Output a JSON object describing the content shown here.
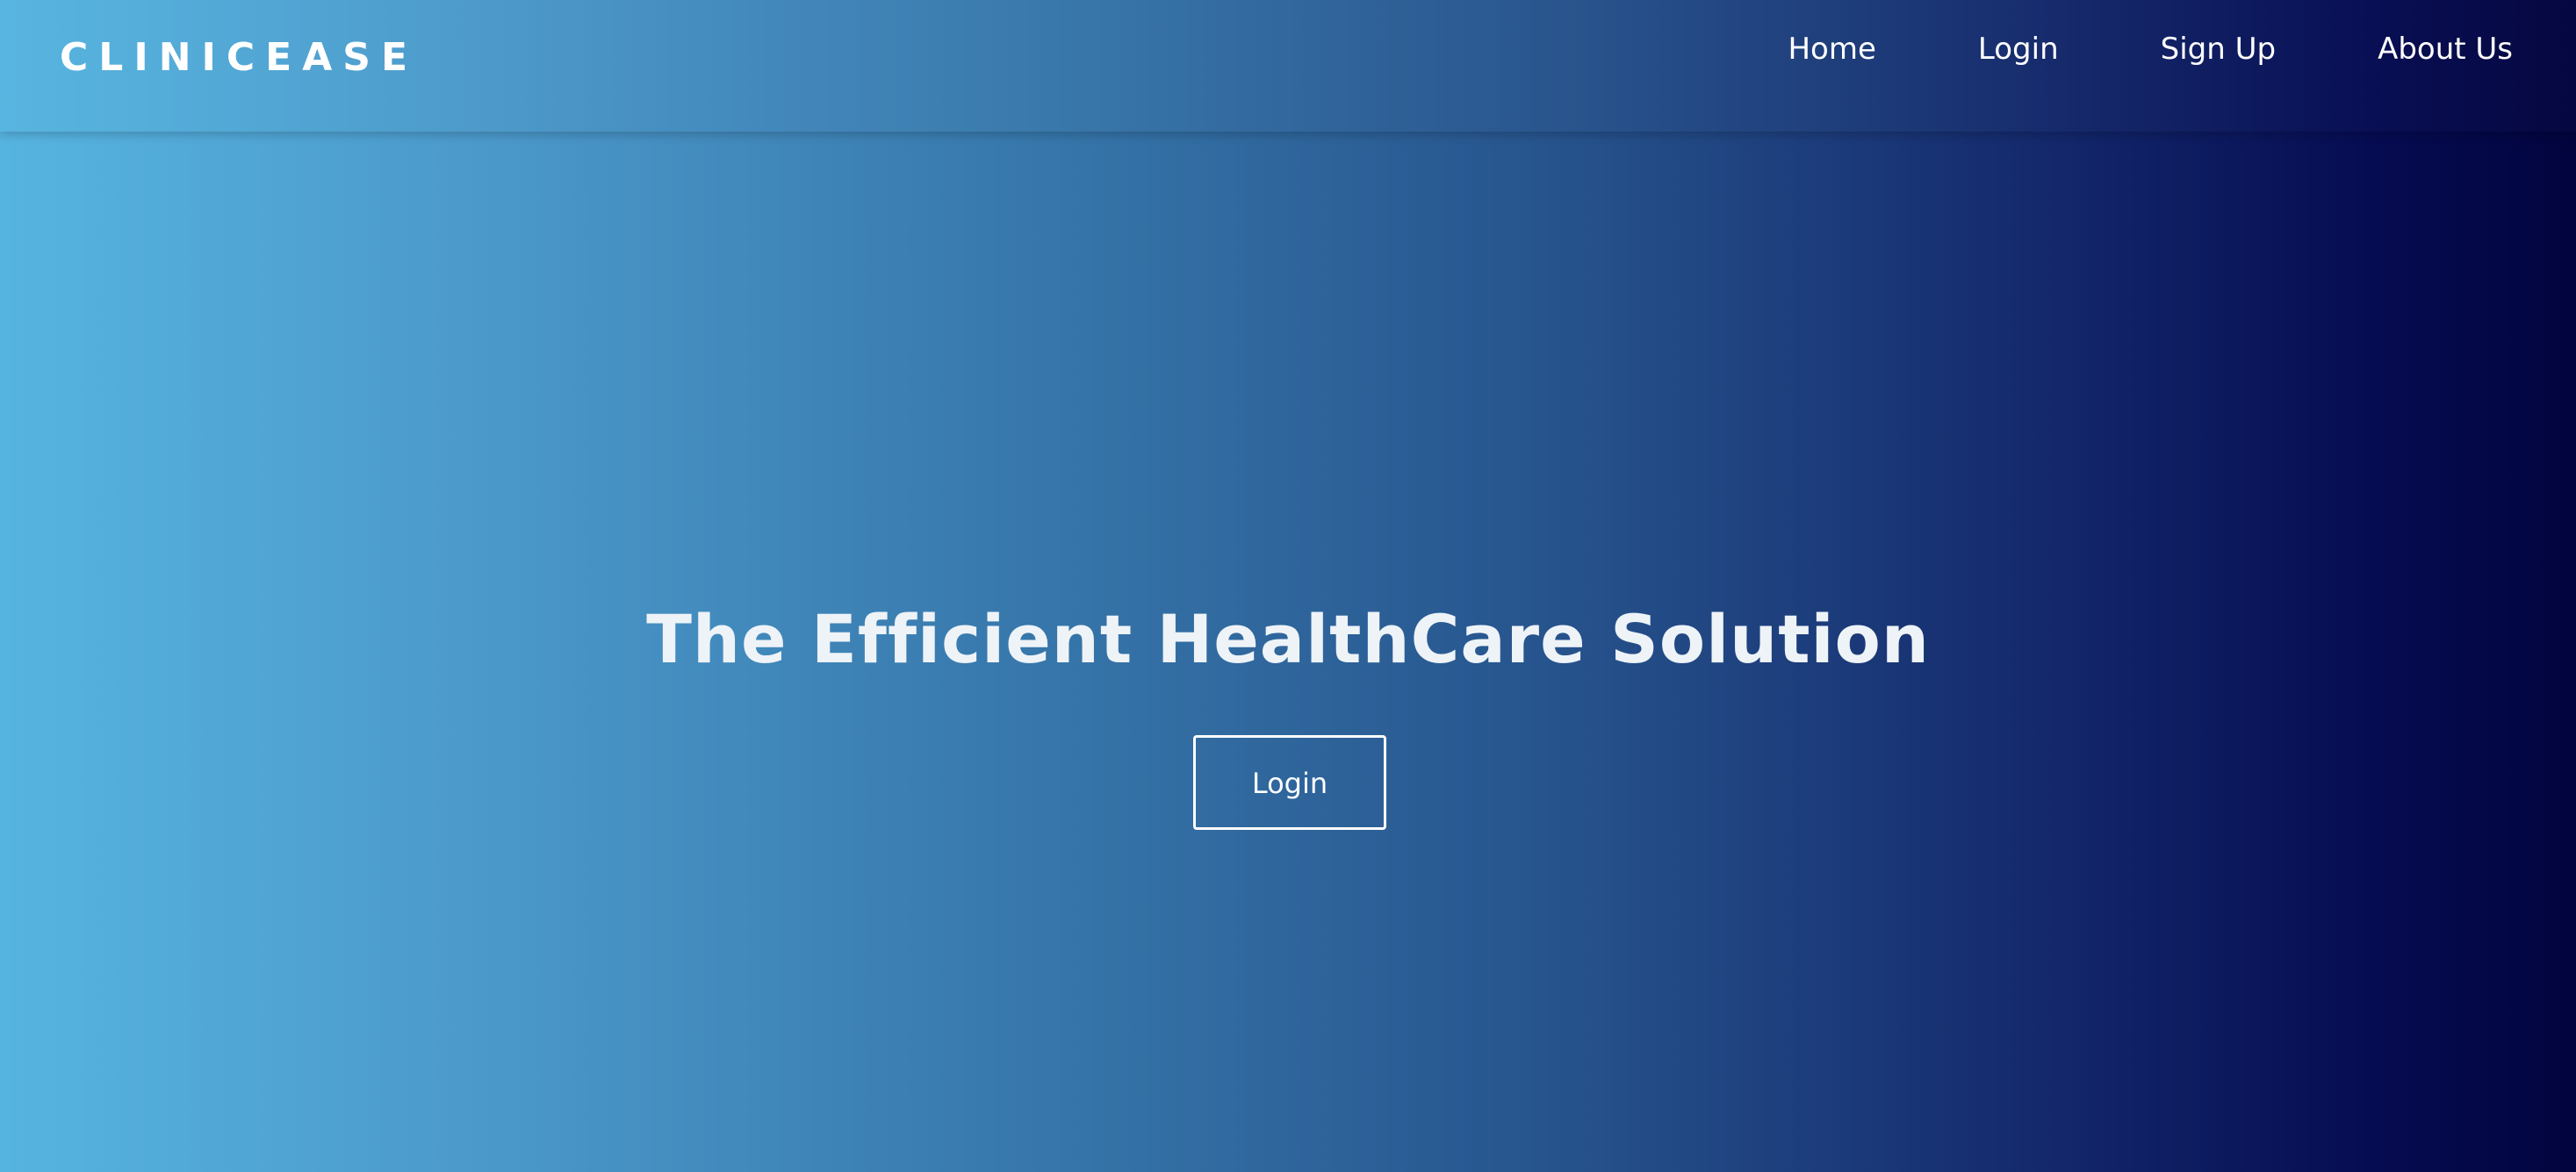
{
  "header": {
    "logo_text": "CLINICEASE",
    "nav": [
      {
        "label": "Home"
      },
      {
        "label": "Login"
      },
      {
        "label": "Sign Up"
      },
      {
        "label": "About Us"
      }
    ]
  },
  "hero": {
    "title": "The Efficient HealthCare Solution",
    "button_label": "Login"
  },
  "colors": {
    "gradient_start": "#56b4e0",
    "gradient_end": "#02043e",
    "text": "#ffffff"
  }
}
